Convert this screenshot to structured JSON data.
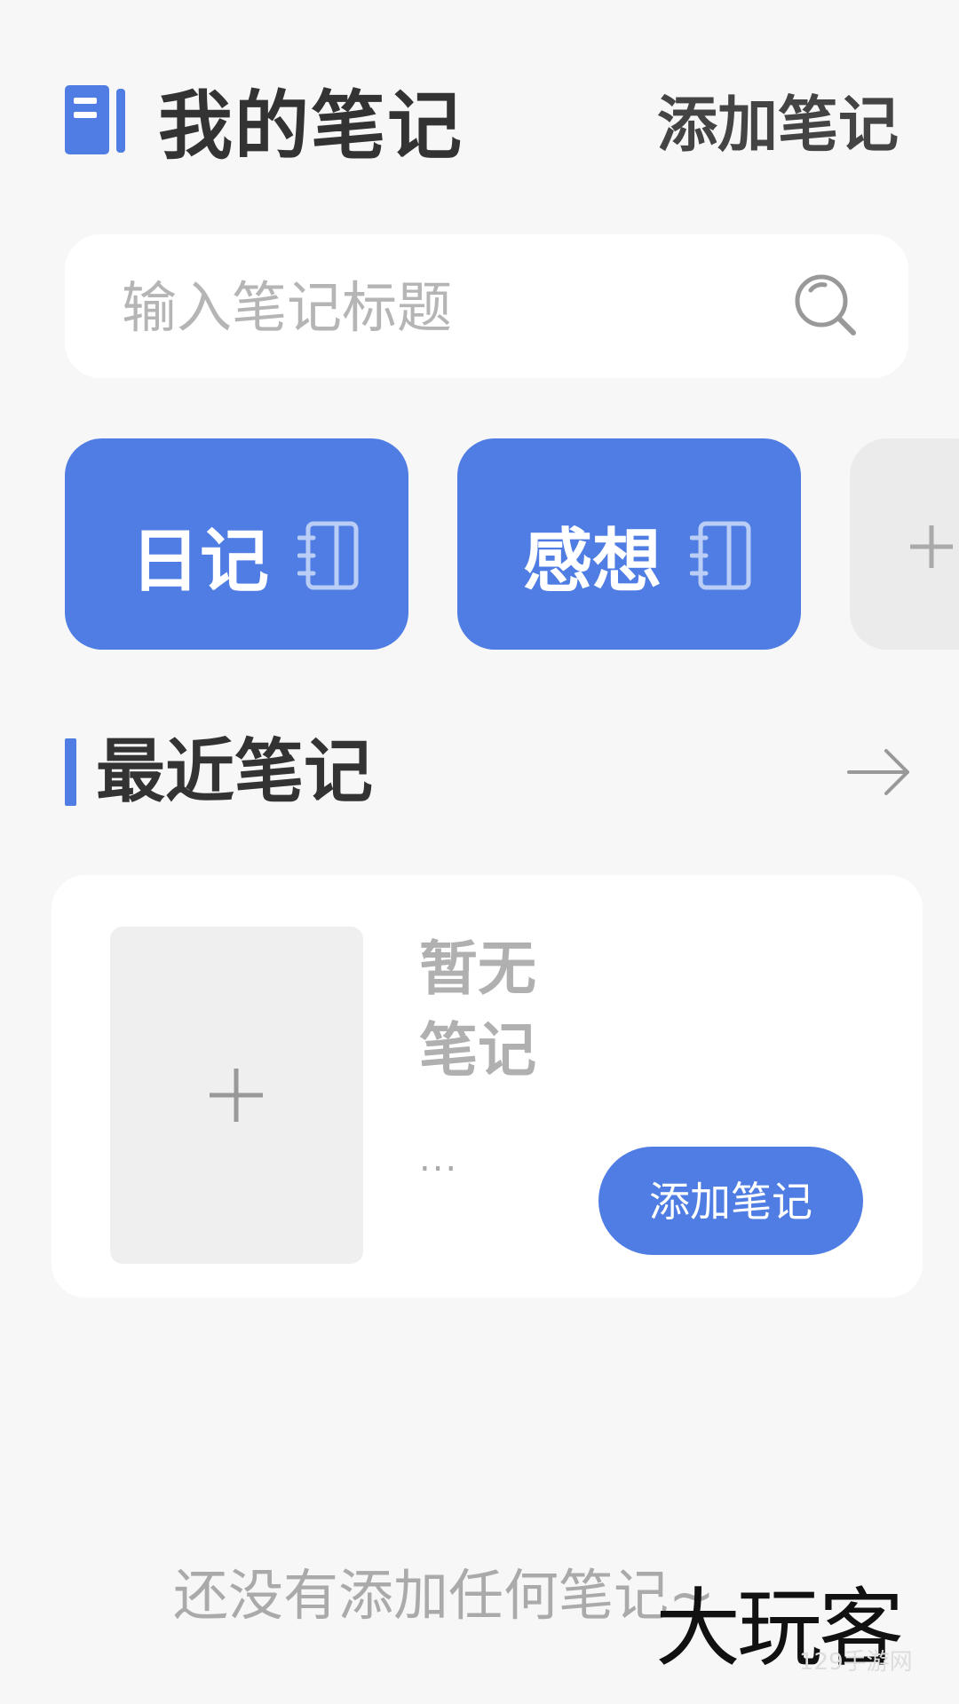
{
  "header": {
    "title": "我的笔记",
    "add_label": "添加笔记",
    "icon": "notebook-icon"
  },
  "search": {
    "placeholder": "输入笔记标题",
    "icon": "search-icon"
  },
  "categories": [
    {
      "label": "日记",
      "icon": "notebook-icon"
    },
    {
      "label": "感想",
      "icon": "notebook-icon"
    }
  ],
  "add_category": {
    "icon": "plus-icon"
  },
  "recent": {
    "title": "最近笔记",
    "arrow_icon": "arrow-right-icon",
    "card": {
      "empty_title": "暂无笔记",
      "ellipsis": "...",
      "add_label": "添加笔记",
      "thumb_icon": "plus-icon"
    }
  },
  "empty_hint": "还没有添加任何笔记~",
  "watermark": {
    "text": "大玩客",
    "sub": "129手游网"
  },
  "colors": {
    "accent": "#4f7de3",
    "background": "#f7f7f7",
    "card": "#ffffff",
    "muted_text": "#aaaaaa"
  }
}
